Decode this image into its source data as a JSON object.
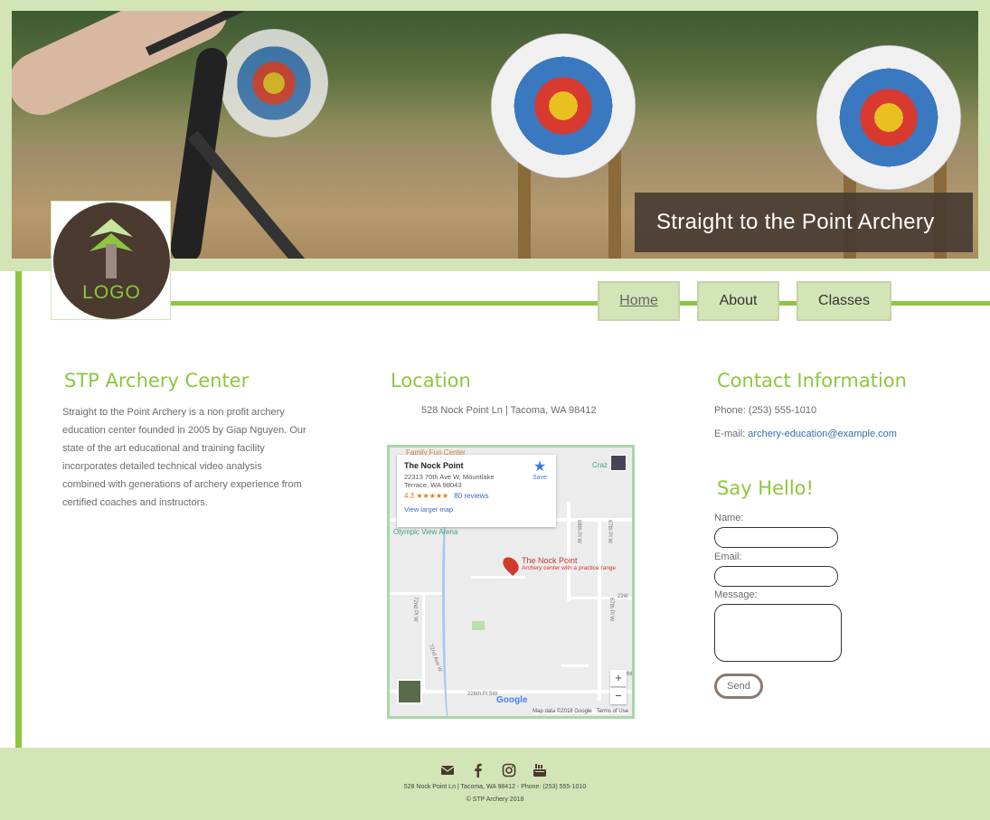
{
  "header": {
    "site_title": "Straight to the Point Archery",
    "logo_text": "LOGO"
  },
  "nav": {
    "items": [
      {
        "label": "Home"
      },
      {
        "label": "About"
      },
      {
        "label": "Classes"
      }
    ]
  },
  "about": {
    "title": "STP Archery Center",
    "text": "Straight to the Point Archery is a non profit archery education center founded in 2005 by Giap Nguyen. Our state of the art educational and training facility incorporates detailed technical video analysis combined with generations of archery experience from certified coaches and instructors."
  },
  "location": {
    "title": "Location",
    "address": "528 Nock Point Ln | Tacoma, WA 98412",
    "map": {
      "place_name": "The Nock Point",
      "place_address": "22313 70th Ave W, Mountlake Terrace, WA 98043",
      "rating": "4.3",
      "stars": "★★★★★",
      "reviews": "80 reviews",
      "save_label": "Save",
      "view_larger": "View larger map",
      "pin_title": "The Nock Point",
      "pin_subtitle": "Archery center with a practice range",
      "label_family": "Family Fun Center",
      "label_olympic": "Olympic View Arena",
      "label_crazy": "Craz",
      "street_226": "226th Pl SW",
      "street_68": "68th Pl W",
      "street_67": "67th Pl W",
      "street_67b": "67th Pl W",
      "street_72": "72nd Pl W",
      "street_72b": "72nd Ave W",
      "street_224": "224t",
      "street_6": "6tl",
      "google": "Google",
      "map_data": "Map data ©2018 Google",
      "terms": "Terms of Use",
      "zoom_in": "+",
      "zoom_out": "−"
    }
  },
  "contact": {
    "title": "Contact Information",
    "phone": "Phone: (253) 555-1010",
    "email_label": "E-mail:",
    "email": "archery-education@example.com"
  },
  "form": {
    "title": "Say Hello!",
    "name_label": "Name:",
    "email_label": "Email:",
    "message_label": "Message:",
    "send_label": "Send"
  },
  "footer": {
    "line1": "528 Nock Point Ln | Tacoma, WA 98412 - Phone: (253) 555-1010",
    "line2": "© STP Archery 2018",
    "icons": [
      "envelope-icon",
      "facebook-icon",
      "instagram-icon",
      "youtube-icon"
    ]
  },
  "colors": {
    "accent": "#8dc63f",
    "light_green": "#d3e4b6",
    "dark_brown": "#4a3a30",
    "link": "#3a6bb0"
  }
}
